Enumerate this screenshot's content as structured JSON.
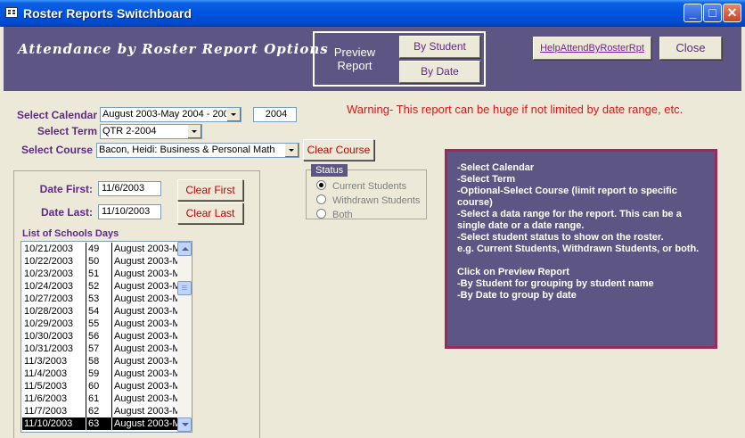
{
  "window": {
    "title": "Roster Reports Switchboard"
  },
  "header": {
    "title": "Attendance by Roster Report Options",
    "preview_label_1": "Preview",
    "preview_label_2": "Report",
    "by_student": "By Student",
    "by_date": "By Date",
    "help_link": "HelpAttendByRosterRpt",
    "close": "Close"
  },
  "form": {
    "calendar_label": "Select Calendar",
    "calendar_value": "August 2003-May 2004 - 200",
    "year_value": "2004",
    "term_label": "Select Term",
    "term_value": "QTR 2-2004",
    "course_label": "Select Course",
    "course_value": "Bacon, Heidi: Business & Personal Math",
    "clear_course": "Clear Course",
    "warning": "Warning- This report can be huge if not limited by date range, etc."
  },
  "status": {
    "title": "Status",
    "options": [
      "Current Students",
      "Withdrawn Students",
      "Both"
    ],
    "selected": "Current Students"
  },
  "dates": {
    "first_label": "Date First:",
    "first_value": "11/6/2003",
    "last_label": "Date Last:",
    "last_value": "11/10/2003",
    "clear_first": "Clear First",
    "clear_last": "Clear Last"
  },
  "school_days": {
    "label": "List of Schools Days",
    "rows": [
      [
        "10/21/2003",
        "49",
        "August 2003-M"
      ],
      [
        "10/22/2003",
        "50",
        "August 2003-M"
      ],
      [
        "10/23/2003",
        "51",
        "August 2003-M"
      ],
      [
        "10/24/2003",
        "52",
        "August 2003-M"
      ],
      [
        "10/27/2003",
        "53",
        "August 2003-M"
      ],
      [
        "10/28/2003",
        "54",
        "August 2003-M"
      ],
      [
        "10/29/2003",
        "55",
        "August 2003-M"
      ],
      [
        "10/30/2003",
        "56",
        "August 2003-M"
      ],
      [
        "10/31/2003",
        "57",
        "August 2003-M"
      ],
      [
        "11/3/2003",
        "58",
        "August 2003-M"
      ],
      [
        "11/4/2003",
        "59",
        "August 2003-M"
      ],
      [
        "11/5/2003",
        "60",
        "August 2003-M"
      ],
      [
        "11/6/2003",
        "61",
        "August 2003-M"
      ],
      [
        "11/7/2003",
        "62",
        "August 2003-M"
      ],
      [
        "11/10/2003",
        "63",
        "August 2003-M"
      ]
    ],
    "selected_index": 14
  },
  "instructions": [
    "-Select Calendar",
    "-Select Term",
    "-Optional-Select Course (limit report to specific course)",
    "-Select a data range for the report.  This can be a single date or a date range.",
    "-Select student status to show on the roster.",
    " e.g. Current Students, Withdrawn Students, or both.",
    "",
    "Click on Preview Report",
    "-By Student for grouping by student name",
    "-By Date to group by date"
  ]
}
